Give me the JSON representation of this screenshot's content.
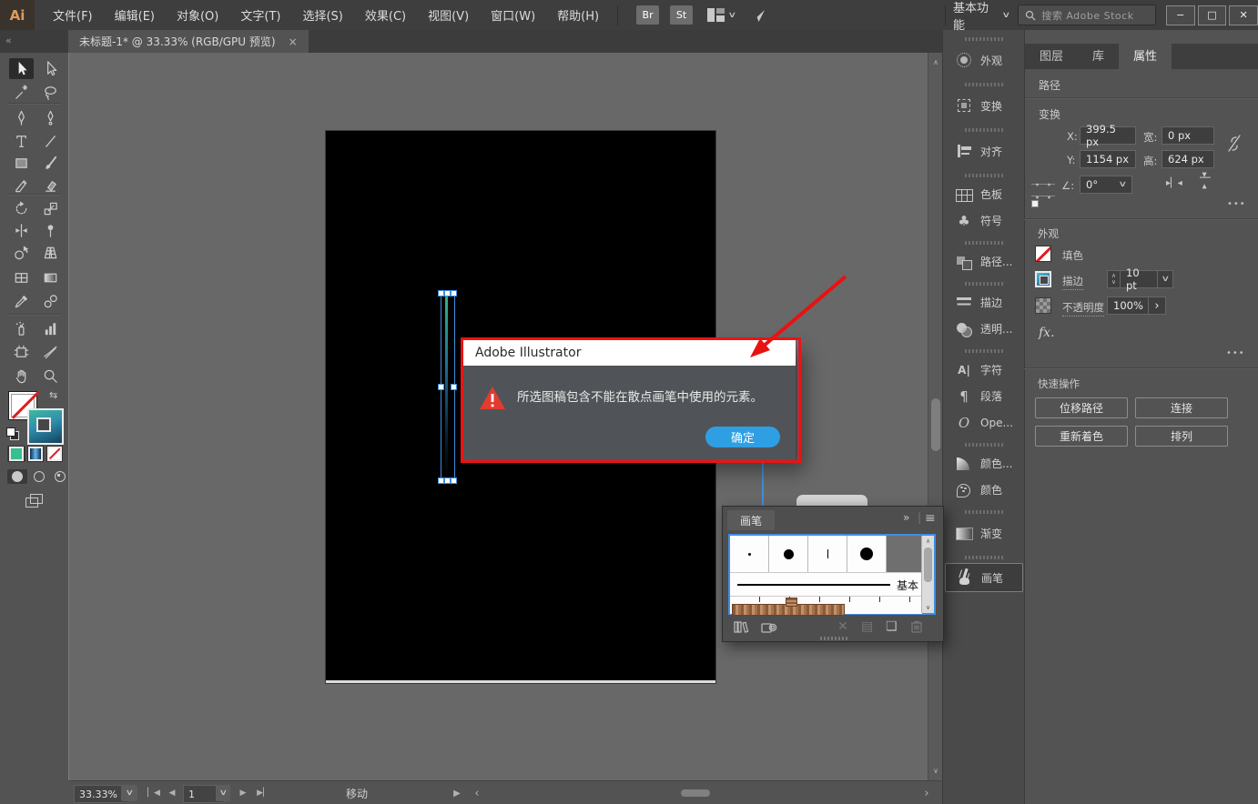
{
  "app_logo": "Ai",
  "menu_bar": {
    "items": [
      "文件(F)",
      "编辑(E)",
      "对象(O)",
      "文字(T)",
      "选择(S)",
      "效果(C)",
      "视图(V)",
      "窗口(W)",
      "帮助(H)"
    ],
    "bridge": "Br",
    "stock": "St"
  },
  "workspace_switcher": "基本功能",
  "search": {
    "placeholder": "搜索 Adobe Stock"
  },
  "window_controls": {
    "minimize": "−",
    "maximize": "□",
    "close": "✕"
  },
  "document_tab": {
    "title": "未标题-1* @ 33.33% (RGB/GPU 预览)",
    "close": "×"
  },
  "toolbar": {
    "tools": [
      "selection",
      "direct-selection",
      "magic-wand",
      "lasso",
      "pen",
      "curvature",
      "type",
      "line-segment",
      "rectangle",
      "paintbrush",
      "shaper",
      "eraser",
      "rotate",
      "scale",
      "width",
      "puppet-warp",
      "shape-builder",
      "perspective-grid",
      "mesh",
      "gradient",
      "eyedropper",
      "blend",
      "symbol-sprayer",
      "column-graph",
      "artboard",
      "slice",
      "hand",
      "zoom"
    ]
  },
  "dialog": {
    "title": "Adobe Illustrator",
    "message": "所选图稿包含不能在散点画笔中使用的元素。",
    "ok": "确定"
  },
  "dock": {
    "items": [
      {
        "label": "外观"
      },
      {
        "label": "变换"
      },
      {
        "label": "对齐"
      },
      {
        "label": "色板"
      },
      {
        "label": "符号"
      },
      {
        "label": "路径..."
      },
      {
        "label": "描边"
      },
      {
        "label": "透明..."
      },
      {
        "label": "字符"
      },
      {
        "label": "段落"
      },
      {
        "label": "Ope..."
      },
      {
        "label": "颜色..."
      },
      {
        "label": "颜色"
      },
      {
        "label": "渐变"
      },
      {
        "label": "画笔"
      }
    ],
    "active_label": "画笔"
  },
  "properties": {
    "tabs": [
      "图层",
      "库",
      "属性"
    ],
    "active_tab": "属性",
    "path_title": "路径",
    "transform": {
      "title": "变换",
      "x_label": "X:",
      "x_value": "399.5 px",
      "y_label": "Y:",
      "y_value": "1154 px",
      "w_label": "宽:",
      "w_value": "0 px",
      "h_label": "高:",
      "h_value": "624 px",
      "angle_label": "∠:",
      "angle_value": "0°"
    },
    "appearance": {
      "title": "外观",
      "fill_label": "填色",
      "stroke_label": "描边",
      "stroke_weight": "10 pt",
      "opacity_label": "不透明度",
      "opacity_value": "100%",
      "fx_label": "fx."
    },
    "quick_actions": {
      "title": "快速操作",
      "buttons": [
        "位移路径",
        "连接",
        "重新着色",
        "排列"
      ]
    }
  },
  "brushes_panel": {
    "title": "画笔",
    "basic_label": "基本"
  },
  "status_bar": {
    "zoom": "33.33%",
    "artboard_number": "1",
    "tool_status": "移动"
  },
  "icons": {
    "chevron_down": "∨",
    "chevron_up": "∧",
    "double_left": "«",
    "double_right": "»",
    "small_left": "‹",
    "small_right": "›",
    "first": "▏◀",
    "prev": "◀",
    "next": "▶",
    "last": "▶▏",
    "menu": "≡",
    "more": "•••",
    "club": "♣",
    "paragraph": "¶",
    "opentype": "O",
    "character": "A|",
    "swap": "⇆",
    "delete_x": "✕",
    "options_list": "▤",
    "new_item": "❏",
    "flip_left": "▸",
    "flip_bar": "▏",
    "flip_right": "◂"
  },
  "colors": {
    "accent_blue": "#3F8EDE",
    "annotation_red": "#EC1313",
    "dialog_button_blue": "#2F9FE3",
    "warning_red": "#E23B30"
  }
}
